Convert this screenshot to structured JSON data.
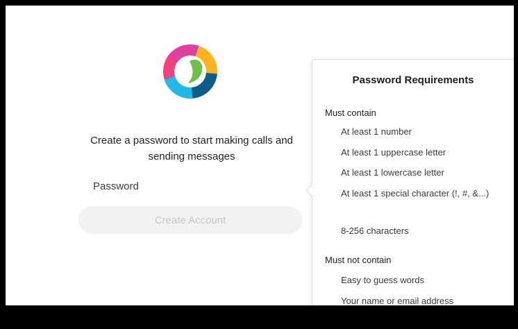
{
  "signup": {
    "subtitle": "Create a password to start making calls and sending messages",
    "password_placeholder": "Password",
    "create_button": "Create Account"
  },
  "logo": {
    "icon": "webex-logo-icon",
    "colors": [
      "#f2417b",
      "#ffb41f",
      "#6dc04a",
      "#0e5c89",
      "#24b8e9",
      "#e03f9f"
    ]
  },
  "requirements": {
    "title": "Password Requirements",
    "must_contain_heading": "Must contain",
    "must_contain": [
      "At least 1 number",
      "At least 1 uppercase letter",
      "At least 1 lowercase letter",
      "At least 1 special character (!, #, &...)",
      "8-256 characters"
    ],
    "must_not_contain_heading": "Must not contain",
    "must_not_contain": [
      "Easy to guess words",
      "Your name or email address"
    ]
  },
  "colors": {
    "button_bg": "#f2f2f2",
    "button_text": "#c6c6c6",
    "frame_border": "#000000"
  }
}
